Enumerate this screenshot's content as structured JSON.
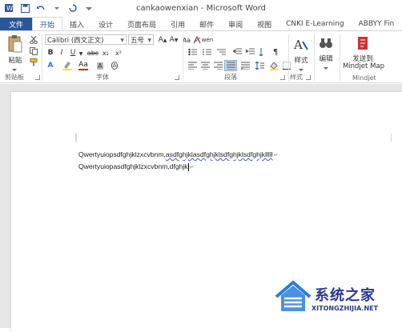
{
  "window": {
    "title": "cankaowenxian - Microsoft Word"
  },
  "tabs": [
    "文件",
    "开始",
    "插入",
    "设计",
    "页面布局",
    "引用",
    "邮件",
    "审阅",
    "视图",
    "CNKI E-Learning",
    "ABBYY Fin"
  ],
  "ribbon": {
    "clipboard": {
      "paste_label": "粘贴",
      "group_label": "剪贴板"
    },
    "font": {
      "font_name": "Calibri (西文正文)",
      "font_size": "五号",
      "group_label": "字体",
      "buttons": [
        "B",
        "I",
        "U",
        "abc",
        "x₂",
        "x²",
        "A",
        "Aa",
        "A",
        "A"
      ]
    },
    "paragraph": {
      "group_label": "段落"
    },
    "styles": {
      "label": "样式",
      "group_label": "样式"
    },
    "editing": {
      "label": "编辑"
    },
    "mindjet": {
      "label_line1": "发送到",
      "label_line2": "Mindjet Map",
      "group_label": "Mindjet"
    }
  },
  "document": {
    "line1_plain": "Qwertyuiopsdfghjklzxcvbnm,",
    "line1_flagged": "asdfghjklasdfghjklsdfghjklsdfghjklllll",
    "line2": "Qwertyuiopasdfghjklzxcvbnm,dfghjk",
    "paragraph_mark": "↵"
  },
  "watermark": {
    "text": "系统之家",
    "url": "XITONGZHIJIA.NET",
    "color": "#2a3a8a"
  },
  "colors": {
    "accent": "#2b579a",
    "spell_underline": "#3b5fc0"
  }
}
